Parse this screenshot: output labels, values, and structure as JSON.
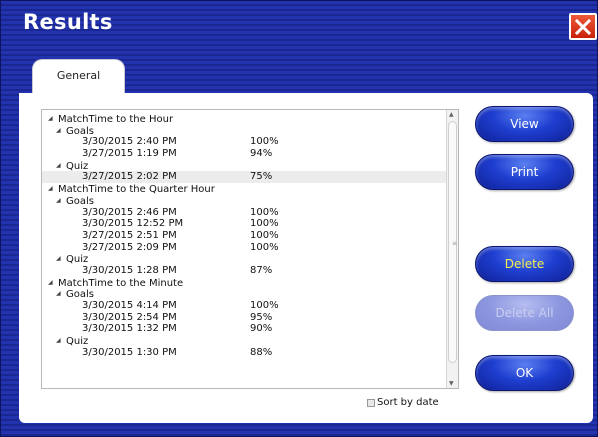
{
  "window": {
    "title": "Results"
  },
  "tabs": [
    {
      "label": "General"
    }
  ],
  "tree": [
    {
      "level": 0,
      "label": "MatchTime to the Hour"
    },
    {
      "level": 1,
      "label": "Goals"
    },
    {
      "level": 2,
      "date": "3/30/2015 2:40 PM",
      "score": "100%"
    },
    {
      "level": 2,
      "date": "3/27/2015 1:19 PM",
      "score": "94%"
    },
    {
      "level": 1,
      "label": "Quiz"
    },
    {
      "level": 2,
      "date": "3/27/2015 2:02 PM",
      "score": "75%",
      "selected": true
    },
    {
      "level": 0,
      "label": "MatchTime to the Quarter Hour"
    },
    {
      "level": 1,
      "label": "Goals"
    },
    {
      "level": 2,
      "date": "3/30/2015 2:46 PM",
      "score": "100%"
    },
    {
      "level": 2,
      "date": "3/30/2015 12:52 PM",
      "score": "100%"
    },
    {
      "level": 2,
      "date": "3/27/2015 2:51 PM",
      "score": "100%"
    },
    {
      "level": 2,
      "date": "3/27/2015 2:09 PM",
      "score": "100%"
    },
    {
      "level": 1,
      "label": "Quiz"
    },
    {
      "level": 2,
      "date": "3/30/2015 1:28 PM",
      "score": "87%"
    },
    {
      "level": 0,
      "label": "MatchTime to the Minute"
    },
    {
      "level": 1,
      "label": "Goals"
    },
    {
      "level": 2,
      "date": "3/30/2015 4:14 PM",
      "score": "100%"
    },
    {
      "level": 2,
      "date": "3/30/2015 2:54 PM",
      "score": "95%"
    },
    {
      "level": 2,
      "date": "3/30/2015 1:32 PM",
      "score": "90%"
    },
    {
      "level": 1,
      "label": "Quiz"
    },
    {
      "level": 2,
      "date": "3/30/2015 1:30 PM",
      "score": "88%"
    }
  ],
  "sort": {
    "label": "Sort by date",
    "checked": false
  },
  "buttons": {
    "view": "View",
    "print": "Print",
    "delete": "Delete",
    "delete_all": "Delete All",
    "ok": "OK"
  },
  "colors": {
    "window_bg": "#2333b0",
    "button_blue": "#1f3fd0",
    "delete_text": "#f4f24e",
    "close_red": "#e0321c"
  },
  "icons": {
    "close": "close-icon",
    "expand": "triangle-down-icon"
  }
}
